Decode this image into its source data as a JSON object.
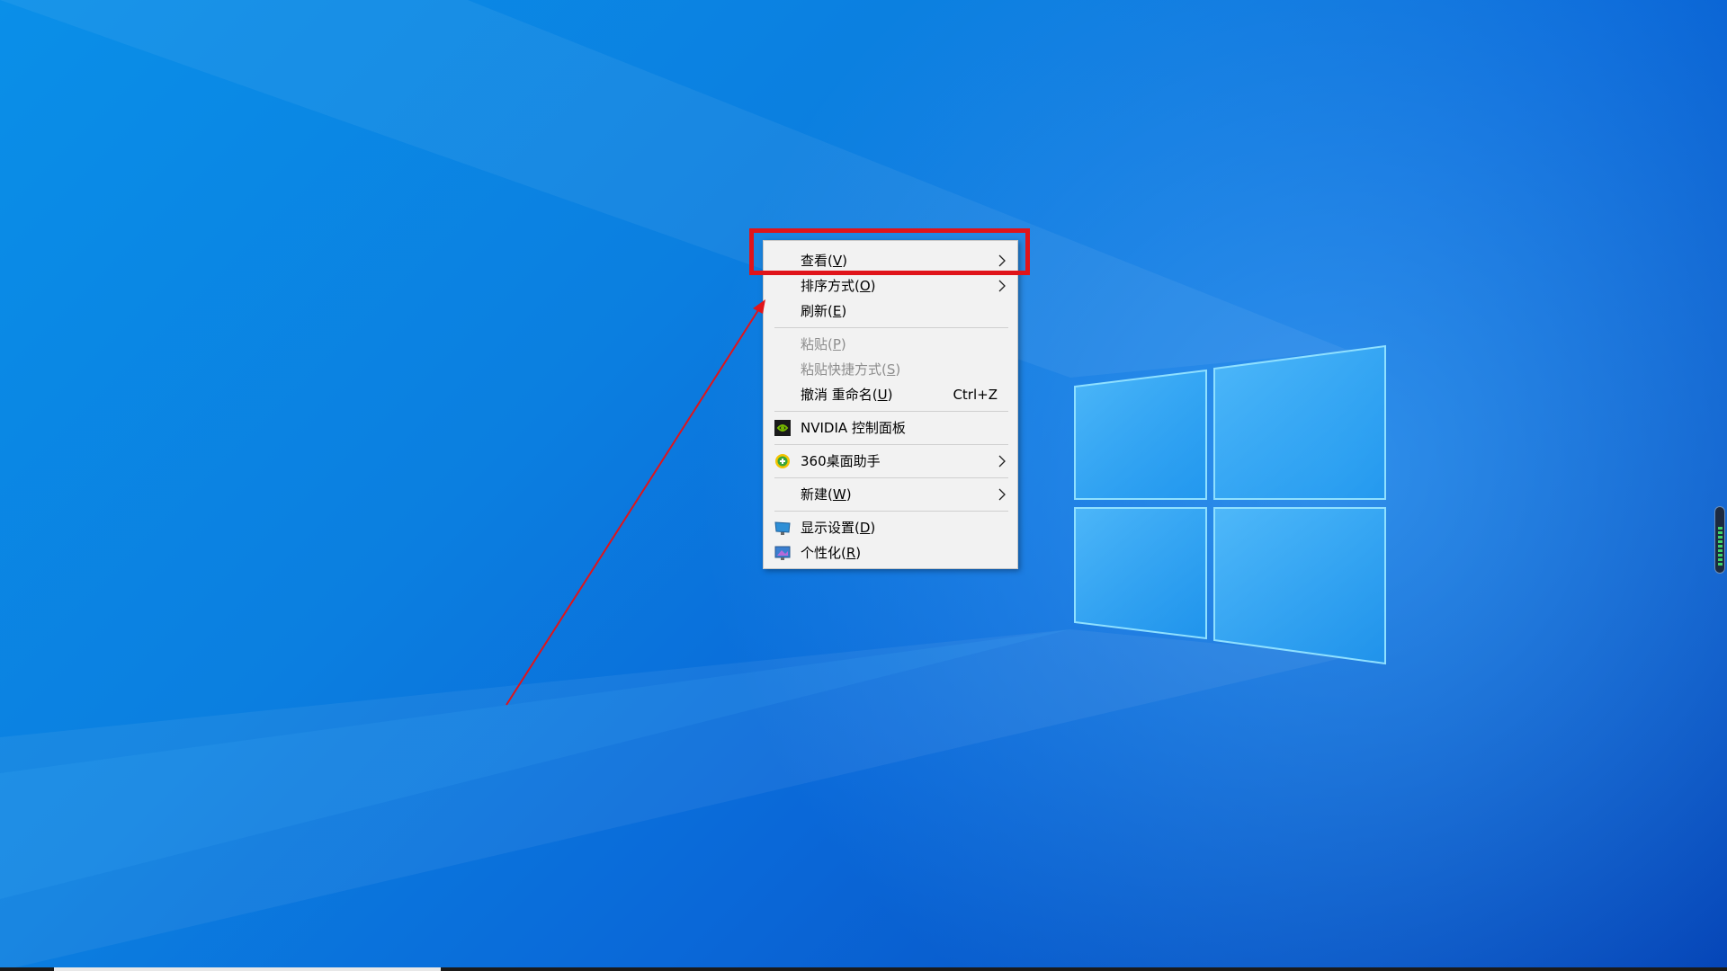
{
  "context_menu": {
    "items": [
      {
        "label": "查看(",
        "key": "V",
        "suffix": ")",
        "submenu": true,
        "disabled": false,
        "highlighted": true
      },
      {
        "label": "排序方式(",
        "key": "O",
        "suffix": ")",
        "submenu": true,
        "disabled": false
      },
      {
        "label": "刷新(",
        "key": "E",
        "suffix": ")",
        "submenu": false,
        "disabled": false
      },
      {
        "label": "粘贴(",
        "key": "P",
        "suffix": ")",
        "submenu": false,
        "disabled": true
      },
      {
        "label": "粘贴快捷方式(",
        "key": "S",
        "suffix": ")",
        "submenu": false,
        "disabled": true
      },
      {
        "label": "撤消 重命名(",
        "key": "U",
        "suffix": ")",
        "shortcut": "Ctrl+Z",
        "submenu": false,
        "disabled": false
      },
      {
        "label": "NVIDIA 控制面板",
        "icon": "nvidia-icon",
        "submenu": false,
        "disabled": false
      },
      {
        "label": "360桌面助手",
        "icon": "360-desktop-helper-icon",
        "submenu": true,
        "disabled": false
      },
      {
        "label": "新建(",
        "key": "W",
        "suffix": ")",
        "submenu": true,
        "disabled": false
      },
      {
        "label": "显示设置(",
        "key": "D",
        "suffix": ")",
        "icon": "display-settings-icon",
        "submenu": false,
        "disabled": false
      },
      {
        "label": "个性化(",
        "key": "R",
        "suffix": ")",
        "icon": "personalize-icon",
        "submenu": false,
        "disabled": false
      }
    ]
  },
  "colors": {
    "desktop_blue": "#0a7fe0",
    "highlight_red": "#e0141a",
    "menu_bg": "#f2f2f2",
    "disabled_text": "#8d8d8d"
  }
}
